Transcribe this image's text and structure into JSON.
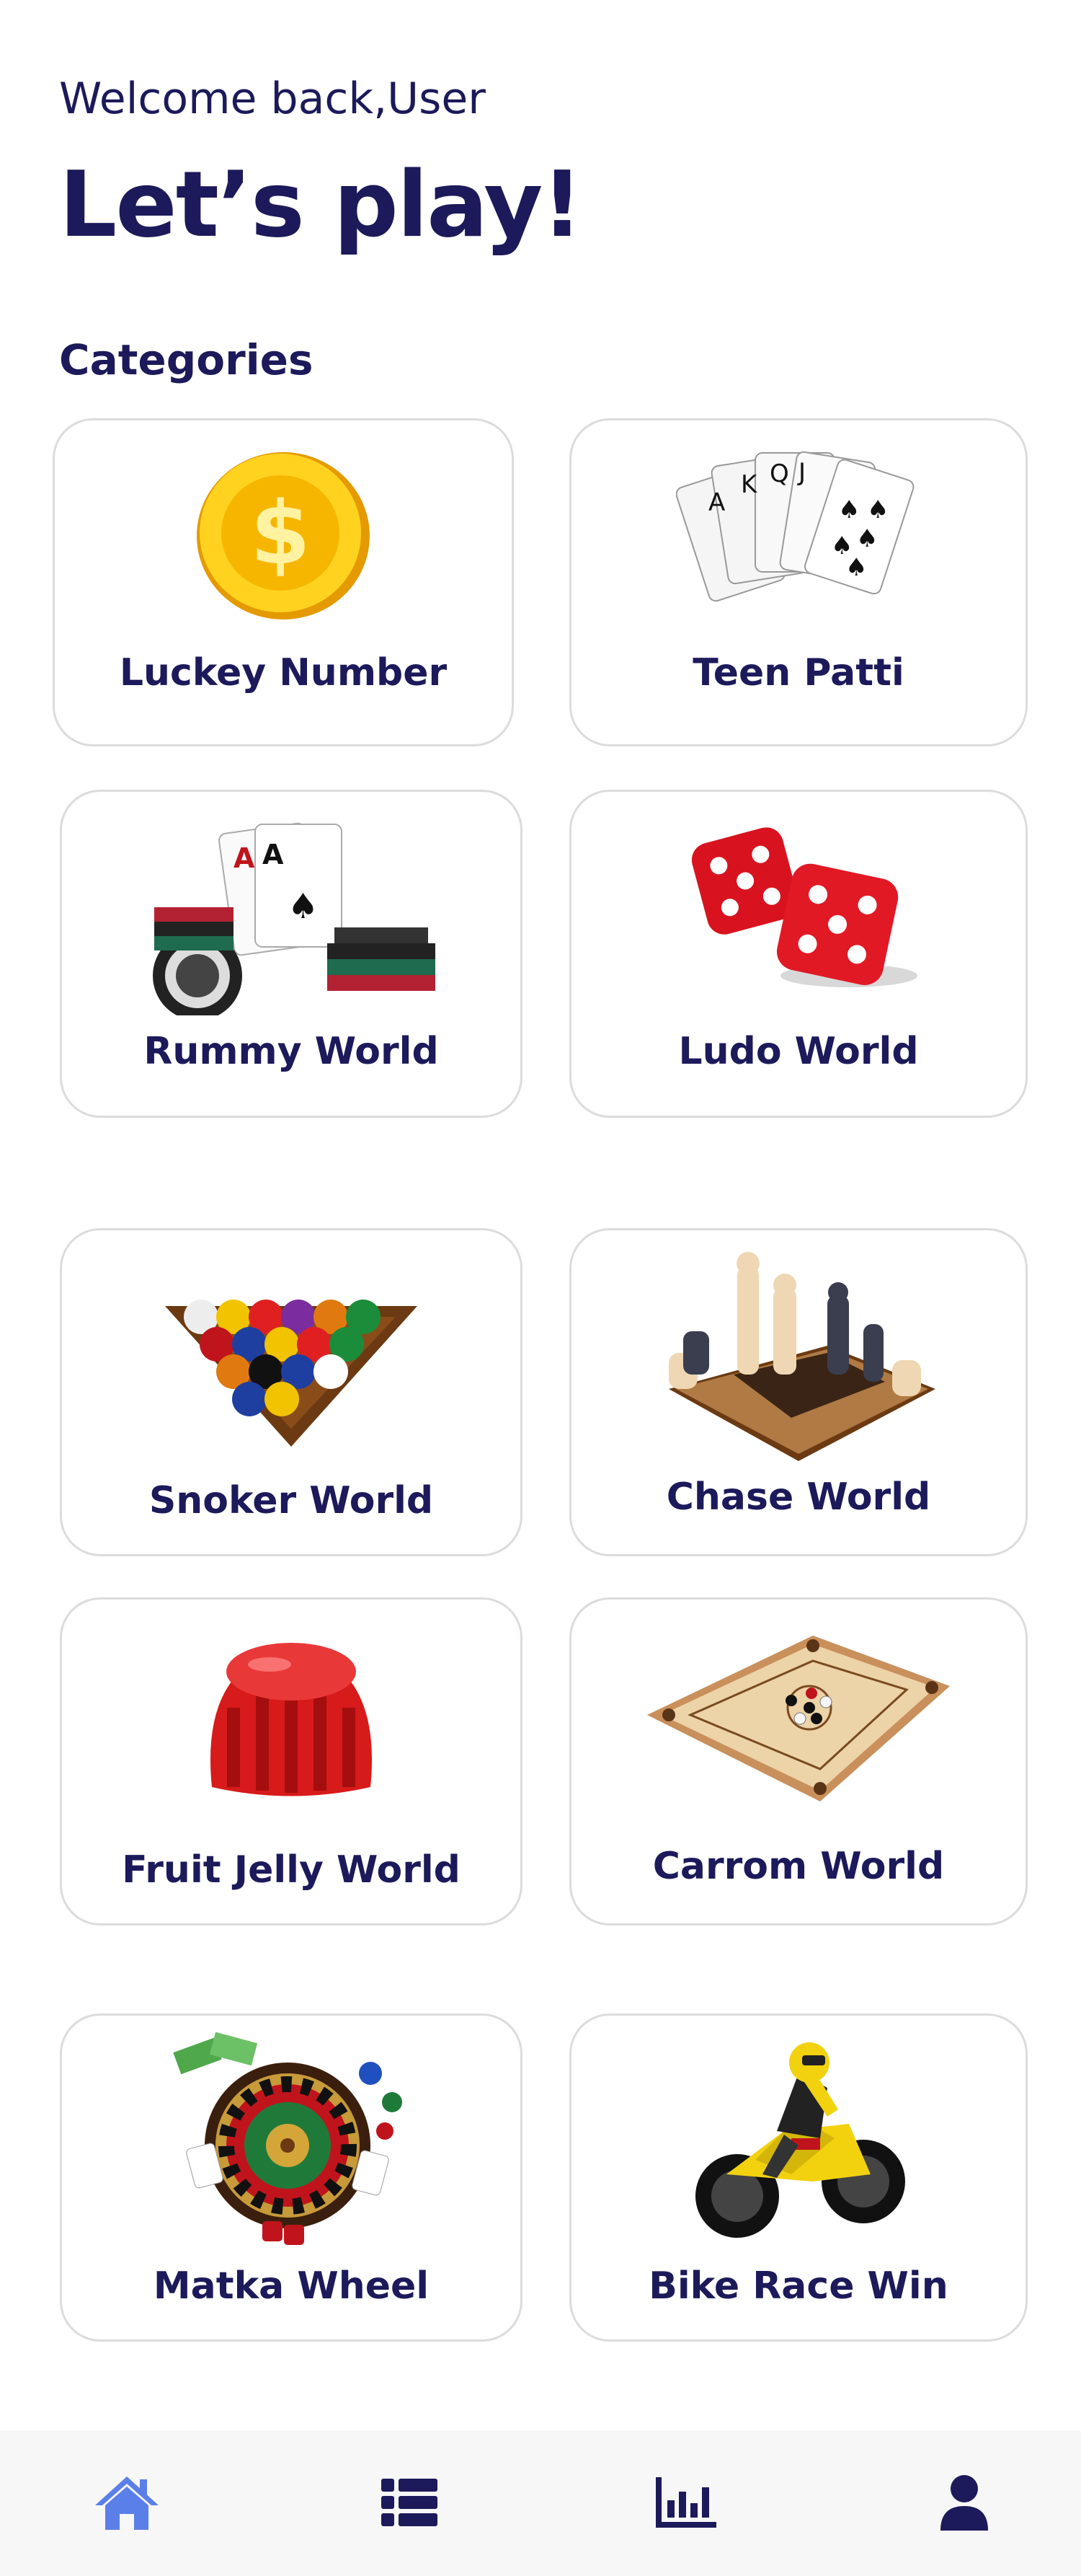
{
  "header": {
    "welcome": "Welcome back,User",
    "title": "Let’s play!"
  },
  "categories": {
    "heading": "Categories",
    "items": [
      {
        "label": "Luckey Number",
        "icon": "gold-coin-icon"
      },
      {
        "label": "Teen Patti",
        "icon": "playing-cards-icon"
      },
      {
        "label": "Rummy World",
        "icon": "cards-and-chips-icon"
      },
      {
        "label": "Ludo World",
        "icon": "dice-icon"
      },
      {
        "label": "Snoker World",
        "icon": "billiard-balls-icon"
      },
      {
        "label": "Chase World",
        "icon": "chess-board-icon"
      },
      {
        "label": "Fruit Jelly World",
        "icon": "jelly-icon"
      },
      {
        "label": "Carrom World",
        "icon": "carrom-board-icon"
      },
      {
        "label": "Matka Wheel",
        "icon": "roulette-wheel-icon"
      },
      {
        "label": "Bike Race Win",
        "icon": "motorbike-icon"
      }
    ]
  },
  "bottom_nav": {
    "items": [
      {
        "icon": "home-icon",
        "active": true
      },
      {
        "icon": "list-icon",
        "active": false
      },
      {
        "icon": "chart-icon",
        "active": false
      },
      {
        "icon": "user-icon",
        "active": false
      }
    ]
  },
  "colors": {
    "primary_text": "#1c1a5a",
    "active_nav": "#5b7fe8",
    "card_border": "#dcdcdc",
    "navbar_bg": "#f7f7f8"
  }
}
